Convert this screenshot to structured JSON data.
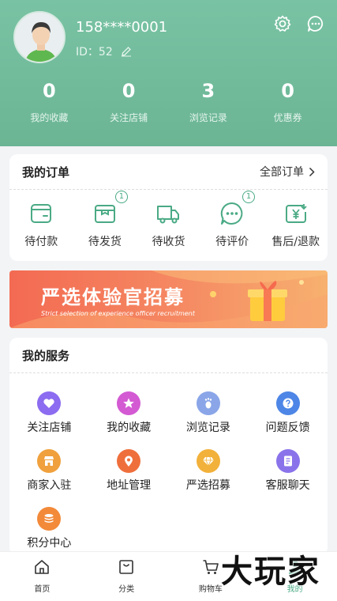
{
  "profile": {
    "phone": "158****0001",
    "id_text": "ID：52"
  },
  "stats": [
    {
      "num": "0",
      "label": "我的收藏"
    },
    {
      "num": "0",
      "label": "关注店铺"
    },
    {
      "num": "3",
      "label": "浏览记录"
    },
    {
      "num": "0",
      "label": "优惠券"
    }
  ],
  "orders": {
    "title": "我的订单",
    "more": "全部订单",
    "items": [
      {
        "label": "待付款",
        "icon": "wallet-icon",
        "badge": ""
      },
      {
        "label": "待发货",
        "icon": "box-icon",
        "badge": "1"
      },
      {
        "label": "待收货",
        "icon": "truck-icon",
        "badge": ""
      },
      {
        "label": "待评价",
        "icon": "chat-dots-icon",
        "badge": "1"
      },
      {
        "label": "售后/退款",
        "icon": "yen-refund-icon",
        "badge": ""
      }
    ]
  },
  "banner": {
    "title": "严选体验官招募",
    "subtitle": "Strict selection of experience officer recruitment"
  },
  "services": {
    "title": "我的服务",
    "items": [
      {
        "label": "关注店铺",
        "icon": "heart-icon",
        "color": "#8c6cf0"
      },
      {
        "label": "我的收藏",
        "icon": "star-icon",
        "color": "#d35ad3"
      },
      {
        "label": "浏览记录",
        "icon": "footprint-icon",
        "color": "#8aa6e8"
      },
      {
        "label": "问题反馈",
        "icon": "question-icon",
        "color": "#4d86e6"
      },
      {
        "label": "商家入驻",
        "icon": "shop-icon",
        "color": "#f0a03c"
      },
      {
        "label": "地址管理",
        "icon": "location-icon",
        "color": "#ef6f3c"
      },
      {
        "label": "严选招募",
        "icon": "diamond-icon",
        "color": "#f2b13a"
      },
      {
        "label": "客服聊天",
        "icon": "document-icon",
        "color": "#8a73ea"
      },
      {
        "label": "积分中心",
        "icon": "coins-icon",
        "color": "#f28a3a"
      }
    ]
  },
  "tabbar": [
    {
      "label": "首页",
      "icon": "home-icon"
    },
    {
      "label": "分类",
      "icon": "bag-icon"
    },
    {
      "label": "购物车",
      "icon": "cart-icon"
    },
    {
      "label": "我的",
      "icon": "user-icon"
    }
  ],
  "watermark": "大玩家",
  "colors": {
    "accent": "#4aaa85",
    "header": "#74bd9c"
  }
}
